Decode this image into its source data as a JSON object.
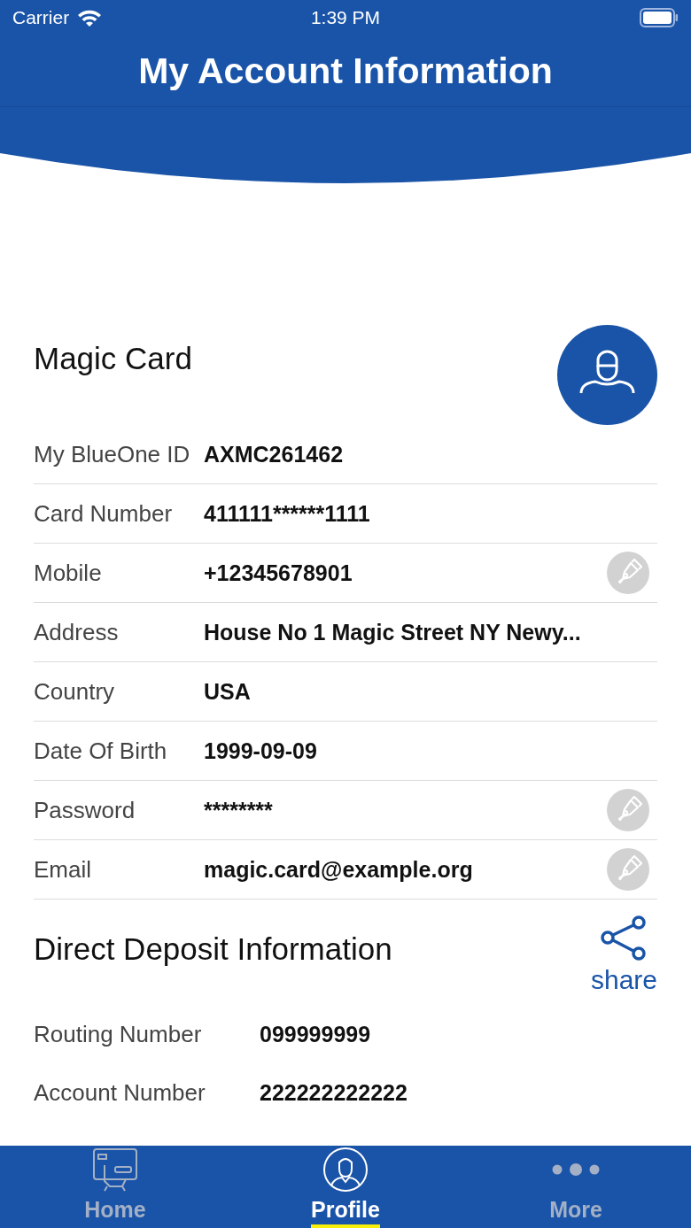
{
  "status_bar": {
    "carrier": "Carrier",
    "time": "1:39 PM"
  },
  "header": {
    "title": "My Account Information"
  },
  "card": {
    "title": "Magic Card",
    "rows": [
      {
        "label": "My BlueOne ID",
        "value": "AXMC261462",
        "editable": false
      },
      {
        "label": "Card Number",
        "value": "411111******1111",
        "editable": false
      },
      {
        "label": "Mobile",
        "value": "+12345678901",
        "editable": true
      },
      {
        "label": "Address",
        "value": "House No 1 Magic Street NY Newy...",
        "editable": false
      },
      {
        "label": "Country",
        "value": "USA",
        "editable": false
      },
      {
        "label": "Date Of Birth",
        "value": "1999-09-09",
        "editable": false
      },
      {
        "label": "Password",
        "value": "********",
        "editable": true
      },
      {
        "label": "Email",
        "value": "magic.card@example.org",
        "editable": true
      }
    ]
  },
  "direct_deposit": {
    "title": "Direct Deposit Information",
    "share_label": "share",
    "rows": [
      {
        "label": "Routing Number",
        "value": "099999999"
      },
      {
        "label": "Account Number",
        "value": "222222222222"
      }
    ]
  },
  "tabs": [
    {
      "kind": "home",
      "label": "Home",
      "selected": false
    },
    {
      "kind": "profile",
      "label": "Profile",
      "selected": true
    },
    {
      "kind": "more",
      "label": "More",
      "selected": false
    }
  ]
}
